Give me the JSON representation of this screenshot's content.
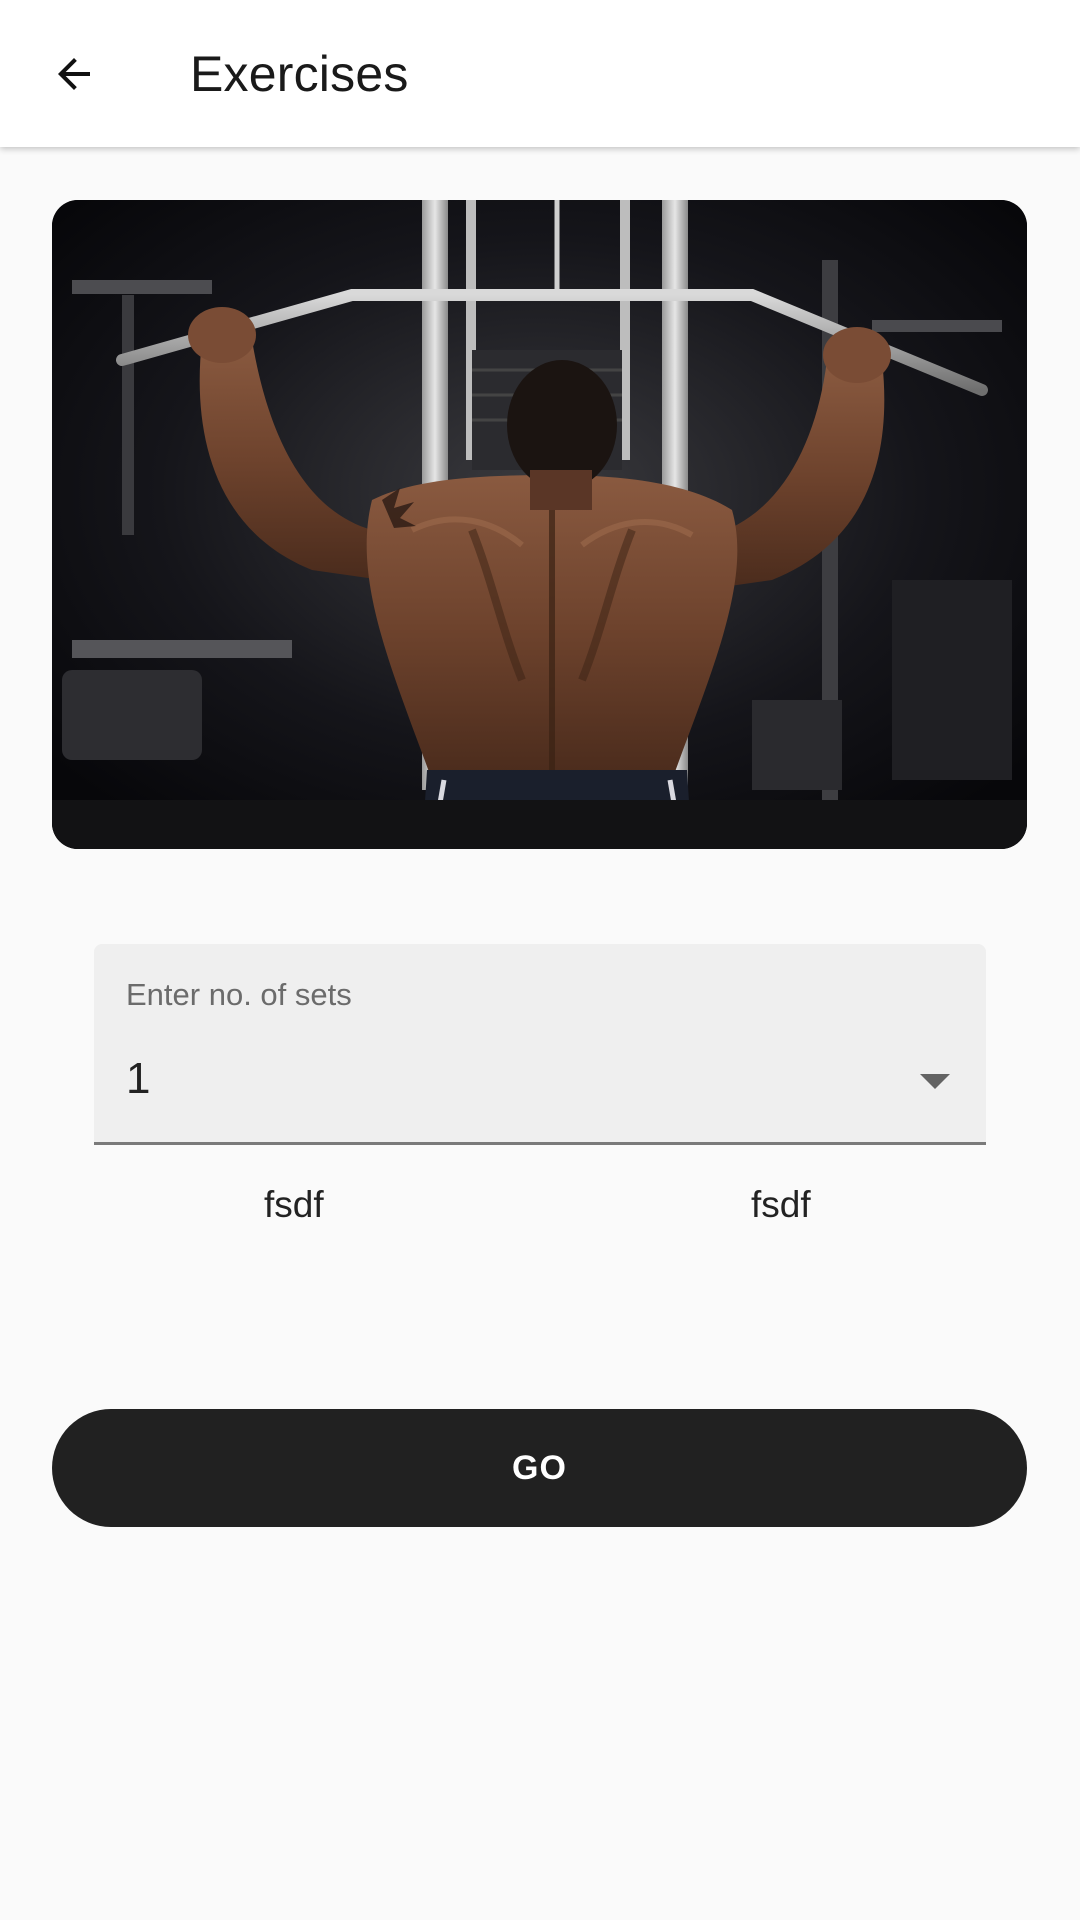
{
  "appbar": {
    "back_icon": "arrow-back-icon",
    "title": "Exercises"
  },
  "hero": {
    "description_icon": "lat-pulldown-photo"
  },
  "sets_field": {
    "label": "Enter no. of sets",
    "value": "1",
    "caret_icon": "dropdown-caret-icon"
  },
  "columns": {
    "left": "fsdf",
    "right": "fsdf"
  },
  "go_button": {
    "label": "GO"
  },
  "colors": {
    "appbar_bg": "#ffffff",
    "page_bg": "#fafafa",
    "button_bg": "#212121",
    "field_bg": "#efefef"
  }
}
